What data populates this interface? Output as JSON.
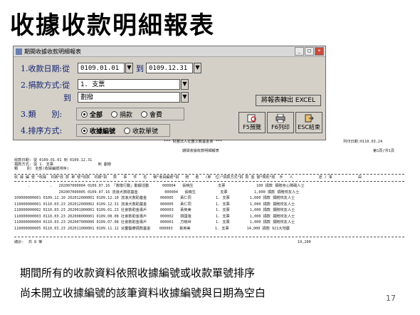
{
  "slide": {
    "title": "收據收款明細報表",
    "captions": [
      "期間所有的收款資料依照收據編號或收款單號排序",
      "尚未開立收據編號的該筆資料收據編號與日期為空白"
    ],
    "page_number": "17"
  },
  "window": {
    "title": "期間收據收款明細報表",
    "row1_label": "1.收款日期:從",
    "date_from": "0109.01.01",
    "to_label": "到",
    "date_to": "0109.12.31",
    "row2_label": "2.捐款方式:從",
    "method_from": "1. 支票",
    "method_to_label": "到",
    "method_to": "劃撥",
    "row3_label": "3.類　　別:",
    "type_options": [
      "全部",
      "捐款",
      "會費"
    ],
    "row4_label": "4.排序方式:",
    "sort_options": [
      "收據編號",
      "收款單號"
    ],
    "export_label": "將報表轉出 EXCEL",
    "buttons": [
      {
        "label": "F5預覽",
        "icon": "preview-icon"
      },
      {
        "label": "F6列印",
        "icon": "printer-icon"
      },
      {
        "label": "ESC結束",
        "icon": "exit-icon"
      }
    ]
  },
  "report": {
    "org": "*** 財團法人社團文教基金會 ***",
    "print_date": "列印日期:0110.03.24",
    "title": "期間收據收款明細報表",
    "page": "第1頁/共1頁",
    "cond1": "收款日期: 從 0109.01.01 到 0109.12.31",
    "cond2": "捐款方式: 從 1. 支票                    到 劃撥",
    "cond3": "類    別: 全部(收據編號排序)",
    "header": "收 據 編 號 *收據  日期*收 款 單 號*收款  日期*捐   款   事   件   名   稱*會員編號*捐   贈   者   (單  位)*捐款方式*捐 款 金 額*類別*經  手   人            途 / 事            由",
    "rows": [
      "      .         .   202007000004 0109.07.16 「救傷行動」動靜活動      000004   張曉生           支票              100 捐款 捐贈身心障礙人士",
      "                    202007000005 0109.07.16 流浪犬救助基金            000004   張曉生           支票            1,000 捐款 捐贈校友人士",
      "109000000001 0109.12.10 202012000001 0109.12.10 流浪犬救助基金      000005   黃仁同           1. 支票         1,000 捐款 捐贈校友人士",
      "110000000001 0110.03.23 202012000002 0109.12.31 流浪犬救助基金      000005   黃仁同           1. 支票         1,000 捐款 捐贈校友人士",
      "110000000002 0110.03.23 202001000001 0109.01.23 社會救助金專戶      000003   黃英美           1. 支票         1,000 捐款 捐贈校友人士",
      "110000000003 0110.03.23 202008000001 0109.08.08 社會救助金專戶      000002   郭國強           1. 支票         1,000 捐款 捐贈校友人士",
      "110000000004 0110.03.23 202007000006 0109.07.08 社會救助金專戶      000001   方曉世           1. 支票         1,000 捐款 捐贈校友人士",
      "110000000005 0110.03.23 202011000001 0109.11.12 兒童醫療捐款基金    000003   黃英美           1. 支票        14,000 捐款 921大地震"
    ],
    "total_label": "總計:  共 8 筆",
    "total_amount": "19,200"
  }
}
